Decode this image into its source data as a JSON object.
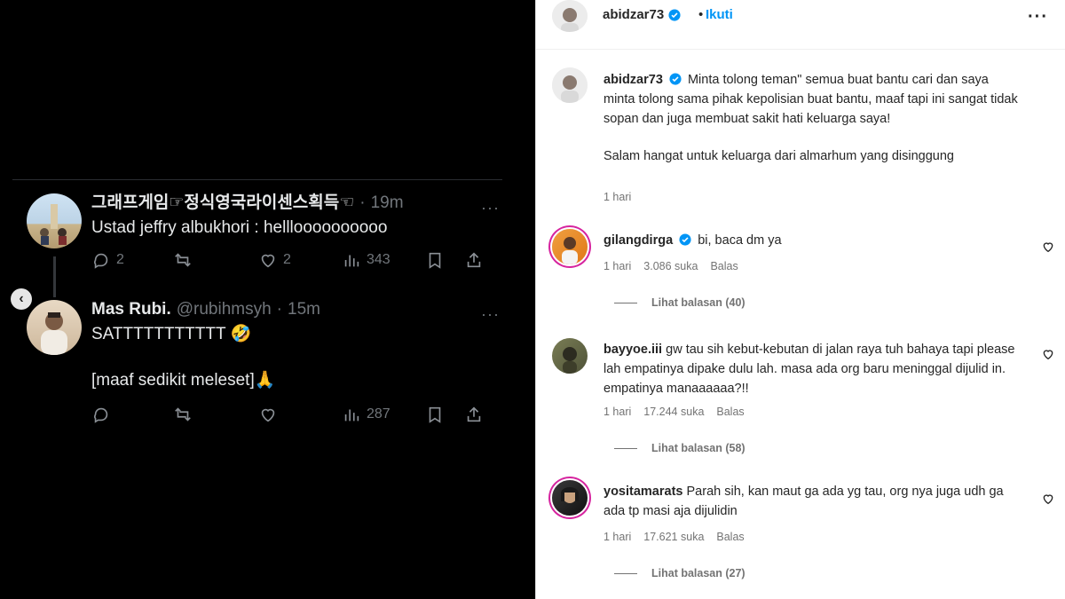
{
  "tweets": [
    {
      "name": "그래프게임☞정식영국라이센스획득☜",
      "dot": "·",
      "time": "19m",
      "text": "Ustad jeffry albukhori : hellloooooooooo",
      "reply_count": "2",
      "like_count": "2",
      "view_count": "343"
    },
    {
      "name": "Mas Rubi.",
      "handle": "@rubihmsyh",
      "dot": "·",
      "time": "15m",
      "text": "SATTTTTTTTTTT 🤣\n\n[maaf sedikit meleset]🙏",
      "view_count": "287"
    }
  ],
  "tweet_more": "···",
  "carousel_prev": "‹",
  "header": {
    "username": "abidzar73",
    "dot": "•",
    "follow_label": "Ikuti",
    "more": "···"
  },
  "caption": {
    "username": "abidzar73",
    "text1": "Minta tolong teman\" semua buat bantu cari dan saya minta tolong sama pihak kepolisian buat bantu, maaf tapi ini sangat tidak sopan dan juga membuat sakit hati keluarga saya!",
    "text2": "Salam hangat untuk keluarga dari almarhum yang disinggung",
    "time": "1 hari"
  },
  "comments": [
    {
      "username": "gilangdirga",
      "text": "bi, baca dm ya",
      "time": "1 hari",
      "likes": "3.086 suka",
      "reply_label": "Balas",
      "view_replies": "Lihat balasan (40)"
    },
    {
      "username": "bayyoe.iii",
      "text": "gw tau sih kebut-kebutan di jalan raya tuh bahaya tapi please lah empatinya dipake dulu lah. masa ada org baru meninggal dijulid in. empatinya manaaaaaa?!!",
      "time": "1 hari",
      "likes": "17.244 suka",
      "reply_label": "Balas",
      "view_replies": "Lihat balasan (58)"
    },
    {
      "username": "yositamarats",
      "text": "Parah sih, kan maut ga ada yg tau, org nya juga udh ga ada tp masi aja dijulidin",
      "time": "1 hari",
      "likes": "17.621 suka",
      "reply_label": "Balas",
      "view_replies": "Lihat balasan (27)"
    }
  ],
  "colors": {
    "follow_blue": "#0095f6",
    "verified_blue": "#0095f6",
    "tweet_bg": "#000000",
    "tweet_text": "#e7e9ea",
    "tweet_muted": "#71767b"
  },
  "icons": [
    "reply-icon",
    "retweet-icon",
    "like-icon",
    "views-icon",
    "bookmark-icon",
    "share-icon",
    "verified-icon",
    "heart-icon"
  ]
}
